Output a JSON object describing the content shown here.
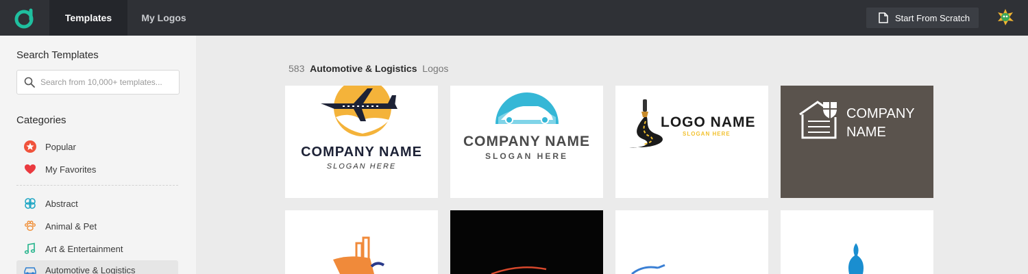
{
  "topbar": {
    "tabs": [
      {
        "label": "Templates",
        "active": true
      },
      {
        "label": "My Logos",
        "active": false
      }
    ],
    "start_button": "Start From Scratch"
  },
  "sidebar": {
    "search_heading": "Search Templates",
    "search_placeholder": "Search from 10,000+ templates...",
    "categories_heading": "Categories",
    "pinned": [
      {
        "label": "Popular",
        "icon": "star-icon"
      },
      {
        "label": "My Favorites",
        "icon": "heart-icon"
      }
    ],
    "items": [
      {
        "label": "Abstract",
        "icon": "abstract-icon"
      },
      {
        "label": "Animal & Pet",
        "icon": "paw-icon"
      },
      {
        "label": "Art & Entertainment",
        "icon": "music-note-icon"
      },
      {
        "label": "Automotive & Logistics",
        "icon": "car-icon",
        "active": true
      }
    ]
  },
  "results": {
    "count": "583",
    "category": "Automotive & Logistics",
    "suffix": "Logos"
  },
  "templates": [
    {
      "name": "COMPANY NAME",
      "slogan": "SLOGAN HERE",
      "motif": "airplane"
    },
    {
      "name": "COMPANY NAME",
      "slogan": "SLOGAN HERE",
      "motif": "car"
    },
    {
      "name": "LOGO NAME",
      "slogan": "SLOGAN HERE",
      "motif": "road-brush"
    },
    {
      "name_line1": "COMPANY",
      "name_line2": "NAME",
      "motif": "garage"
    }
  ],
  "colors": {
    "topbar": "#2f3136",
    "brand": "#1fbf9f",
    "sidebar": "#f4f4f4",
    "canvas": "#ebebeb",
    "garage_card": "#5a534d"
  }
}
